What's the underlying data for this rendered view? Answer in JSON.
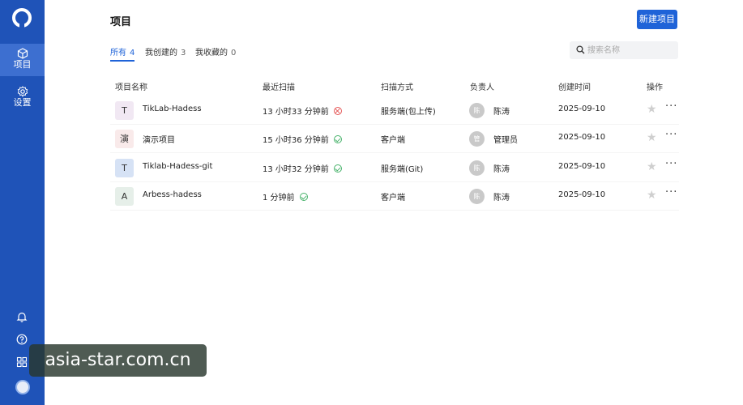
{
  "sidebar": {
    "items": [
      {
        "label": "项目",
        "icon": "cube-icon",
        "active": true
      },
      {
        "label": "设置",
        "icon": "gear-icon",
        "active": false
      }
    ],
    "bottom_icons": [
      "bell-icon",
      "help-icon",
      "apps-grid-icon",
      "avatar"
    ]
  },
  "header": {
    "title": "项目",
    "new_button": "新建项目"
  },
  "tabs": [
    {
      "label": "所有",
      "count": "4",
      "active": true
    },
    {
      "label": "我创建的",
      "count": "3",
      "active": false
    },
    {
      "label": "我收藏的",
      "count": "0",
      "active": false
    }
  ],
  "search": {
    "placeholder": "搜索名称",
    "value": ""
  },
  "table": {
    "columns": [
      "项目名称",
      "最近扫描",
      "扫描方式",
      "负责人",
      "创建时间",
      "操作"
    ],
    "rows": [
      {
        "icon_char": "T",
        "icon_bg": "#f1e8f3",
        "name": "TikLab-Hadess",
        "last_scan": "13 小时33 分钟前",
        "status": "fail",
        "method": "服务端(包上传)",
        "avatar_char": "陈",
        "owner": "陈涛",
        "created": "2025-09-10"
      },
      {
        "icon_char": "演",
        "icon_bg": "#f9eaea",
        "name": "演示项目",
        "last_scan": "15 小时36 分钟前",
        "status": "ok",
        "method": "客户端",
        "avatar_char": "管",
        "owner": "管理员",
        "created": "2025-09-10"
      },
      {
        "icon_char": "T",
        "icon_bg": "#d6e2f5",
        "name": "Tiklab-Hadess-git",
        "last_scan": "13 小时32 分钟前",
        "status": "ok",
        "method": "服务端(Git)",
        "avatar_char": "陈",
        "owner": "陈涛",
        "created": "2025-09-10"
      },
      {
        "icon_char": "A",
        "icon_bg": "#e6efe9",
        "name": "Arbess-hadess",
        "last_scan": "1 分钟前",
        "status": "ok",
        "method": "客户端",
        "avatar_char": "陈",
        "owner": "陈涛",
        "created": "2025-09-10"
      }
    ]
  },
  "watermark": "asia-star.com.cn",
  "colors": {
    "sidebar": "#1f53b8",
    "accent": "#1f63d8",
    "fail": "#e65c5c",
    "ok": "#47b26a"
  }
}
